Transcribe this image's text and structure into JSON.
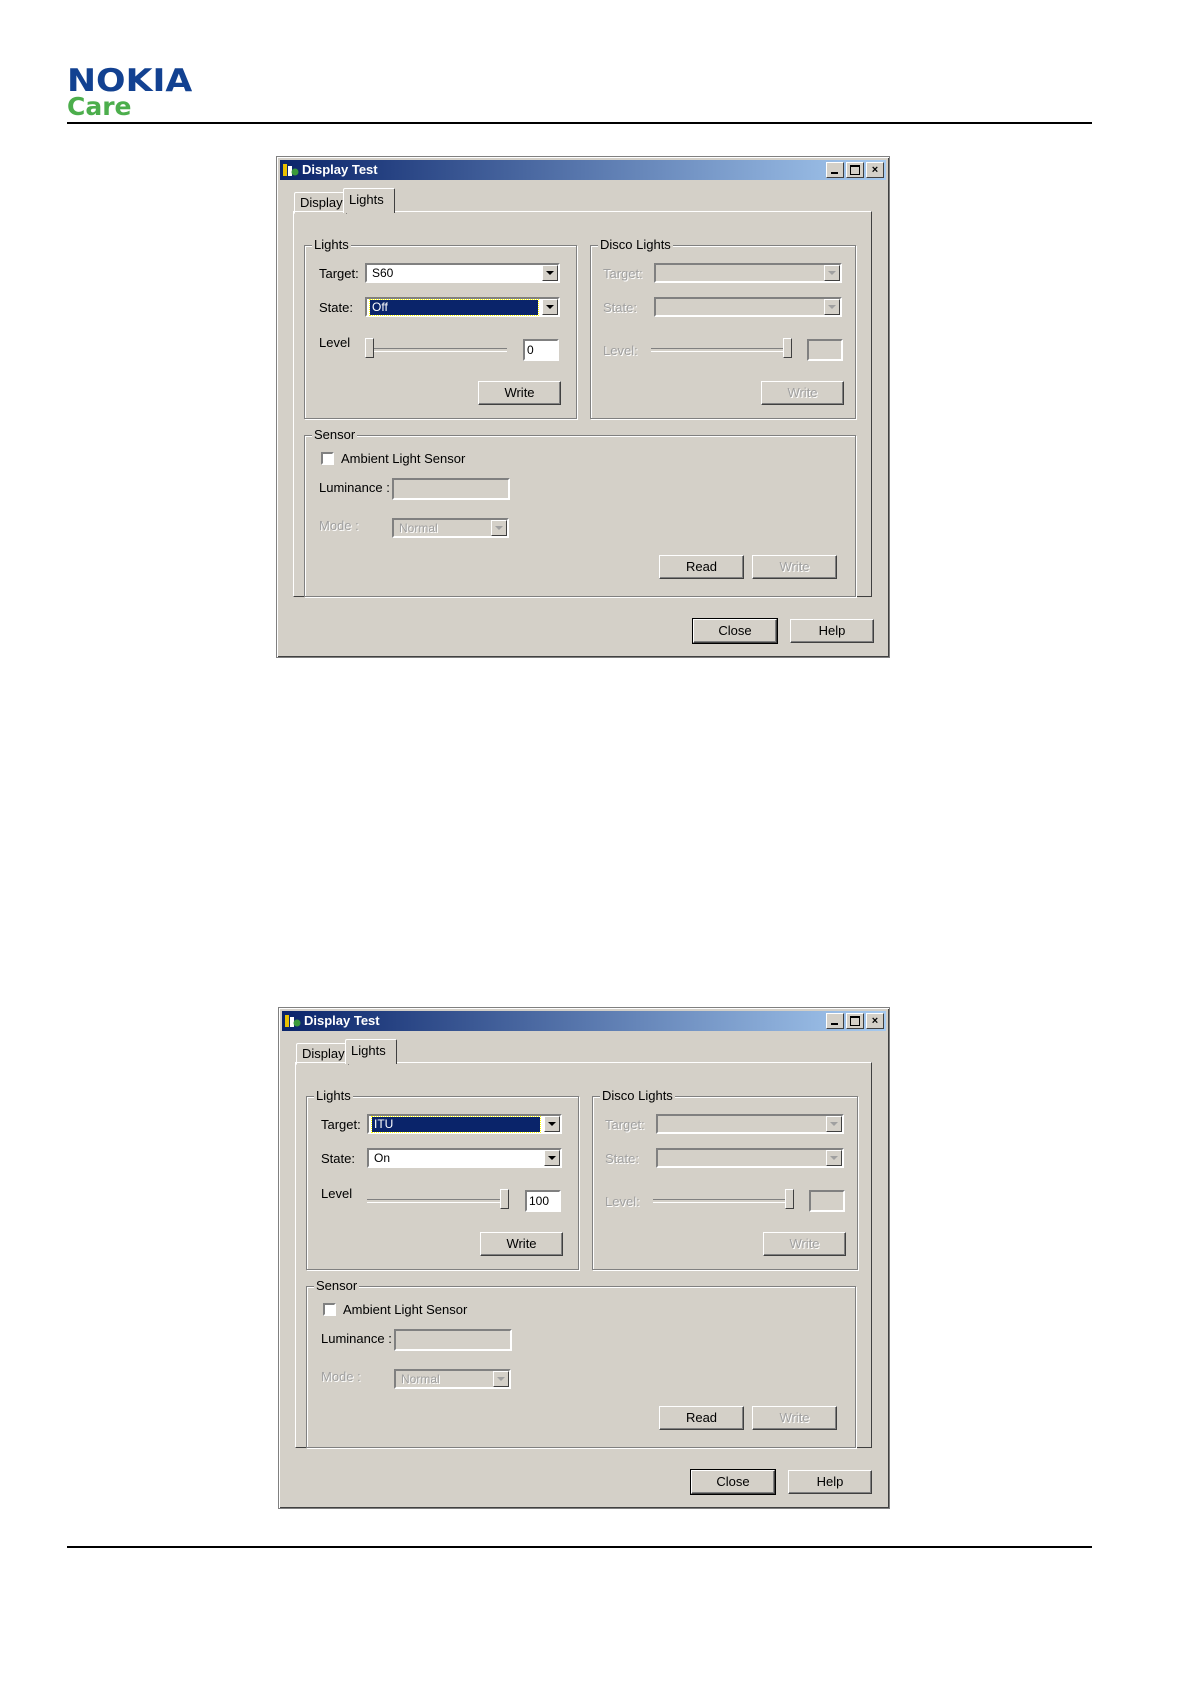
{
  "header": {
    "brand": "NOKIA",
    "subbrand": "Care"
  },
  "windows": [
    {
      "title": "Display Test",
      "tabs": [
        "Display",
        "Lights"
      ],
      "lights": {
        "group_label": "Lights",
        "target_label": "Target:",
        "target_value": "S60",
        "state_label": "State:",
        "state_value": "Off",
        "level_label": "Level",
        "level_value": "0",
        "write_label": "Write"
      },
      "disco": {
        "group_label": "Disco Lights",
        "target_label": "Target:",
        "state_label": "State:",
        "level_label": "Level:",
        "write_label": "Write"
      },
      "sensor": {
        "group_label": "Sensor",
        "ambient_label": "Ambient Light Sensor",
        "luminance_label": "Luminance :",
        "mode_label": "Mode :",
        "mode_value": "Normal",
        "read_label": "Read",
        "write_label": "Write"
      },
      "footer": {
        "close_label": "Close",
        "help_label": "Help"
      }
    },
    {
      "title": "Display Test",
      "tabs": [
        "Display",
        "Lights"
      ],
      "lights": {
        "group_label": "Lights",
        "target_label": "Target:",
        "target_value": "ITU",
        "state_label": "State:",
        "state_value": "On",
        "level_label": "Level",
        "level_value": "100",
        "write_label": "Write"
      },
      "disco": {
        "group_label": "Disco Lights",
        "target_label": "Target:",
        "state_label": "State:",
        "level_label": "Level:",
        "write_label": "Write"
      },
      "sensor": {
        "group_label": "Sensor",
        "ambient_label": "Ambient Light Sensor",
        "luminance_label": "Luminance :",
        "mode_label": "Mode :",
        "mode_value": "Normal",
        "read_label": "Read",
        "write_label": "Write"
      },
      "footer": {
        "close_label": "Close",
        "help_label": "Help"
      }
    }
  ],
  "colors": {
    "brand_blue": "#124191",
    "care_green": "#4cae4c",
    "title_bar": "#0a246a"
  },
  "icons": [
    "app-icon",
    "minimize-icon",
    "maximize-icon",
    "close-icon",
    "dropdown-arrow-icon"
  ]
}
